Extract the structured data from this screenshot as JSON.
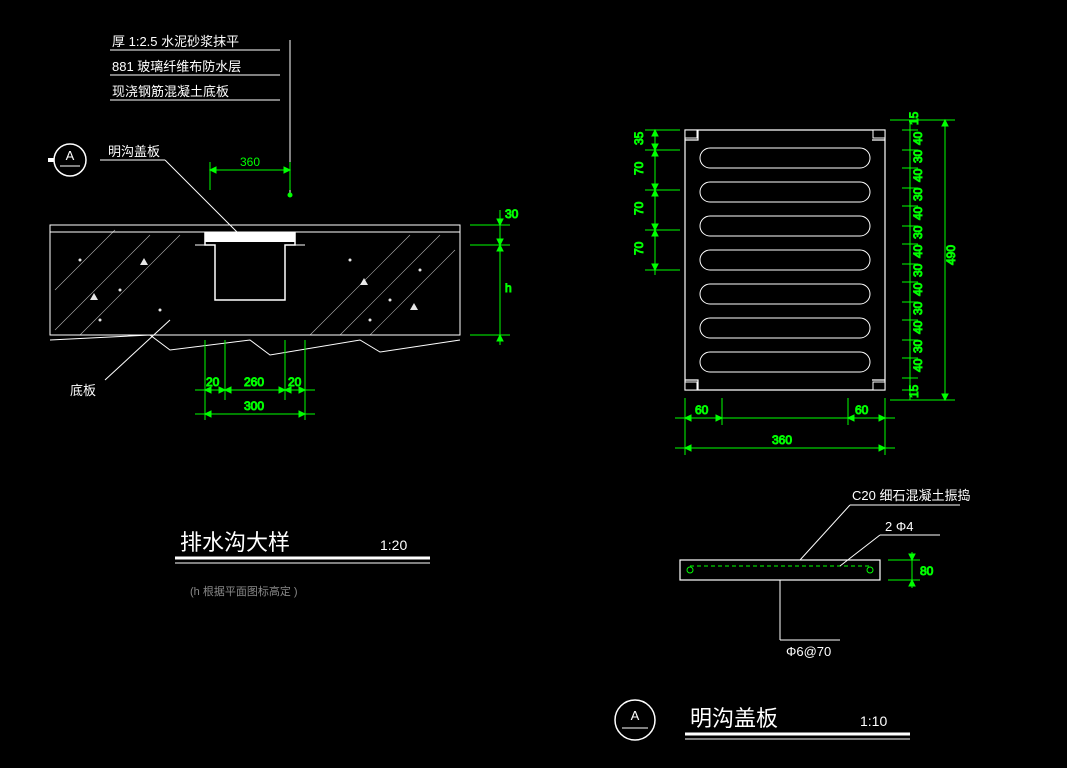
{
  "left": {
    "notes": {
      "n1": "厚 1:2.5 水泥砂浆抹平",
      "n2": "881 玻璃纤维布防水层",
      "n3": "现浇钢筋混凝土底板"
    },
    "callouts": {
      "coverLabel": "明沟盖板",
      "bottomLabel": "底板"
    },
    "dims": {
      "d360": "360",
      "d30": "30",
      "dh": "h",
      "d20a": "20",
      "d260": "260",
      "d20b": "20",
      "d300": "300"
    },
    "title": "排水沟大样",
    "scale": "1:20",
    "note_h": "(h 根据平面图标高定  )",
    "markerA": "A"
  },
  "right": {
    "plan": {
      "left_dims": {
        "t1": "35",
        "t2": "70",
        "t3": "70",
        "t4": "70"
      },
      "right_dims": {
        "top15": "15",
        "r1": "40",
        "r2": "30",
        "r3": "40",
        "r4": "30",
        "r5": "40",
        "r6": "30",
        "r7": "40",
        "r8": "30",
        "r9": "40",
        "r10": "30",
        "r11": "40",
        "r12": "30",
        "r13": "40",
        "bot15": "15",
        "total": "490"
      },
      "bottom_dims": {
        "b60a": "60",
        "b60b": "60",
        "b360": "360"
      }
    },
    "sec": {
      "mat": "C20 细石混凝土振捣",
      "rebar_top": "2 Φ4",
      "rebar_bot": "Φ6@70",
      "t80": "80"
    },
    "title": "明沟盖板",
    "scale": "1:10",
    "markerA": "A"
  }
}
